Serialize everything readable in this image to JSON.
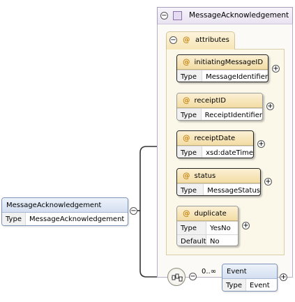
{
  "root": {
    "name": "MessageAcknowledgement",
    "type_label": "Type",
    "type_value": "MessageAcknowledgement"
  },
  "complex_type": {
    "name": "MessageAcknowledgement"
  },
  "attributes_group": {
    "label": "attributes"
  },
  "attributes": [
    {
      "name": "initiatingMessageID",
      "rows": [
        {
          "label": "Type",
          "value": "MessageIdentifier"
        }
      ]
    },
    {
      "name": "receiptID",
      "rows": [
        {
          "label": "Type",
          "value": "ReceiptIdentifier"
        }
      ]
    },
    {
      "name": "receiptDate",
      "rows": [
        {
          "label": "Type",
          "value": "xsd:dateTime"
        }
      ]
    },
    {
      "name": "status",
      "rows": [
        {
          "label": "Type",
          "value": "MessageStatus"
        }
      ]
    },
    {
      "name": "duplicate",
      "rows": [
        {
          "label": "Type",
          "value": "YesNo"
        },
        {
          "label": "Default",
          "value": "No"
        }
      ]
    }
  ],
  "sequence": {
    "cardinality": "0..∞",
    "element": {
      "name": "Event",
      "type_label": "Type",
      "type_value": "Event"
    }
  },
  "symbols": {
    "collapse": "⊖",
    "expand": "+",
    "attr_marker": "@"
  }
}
